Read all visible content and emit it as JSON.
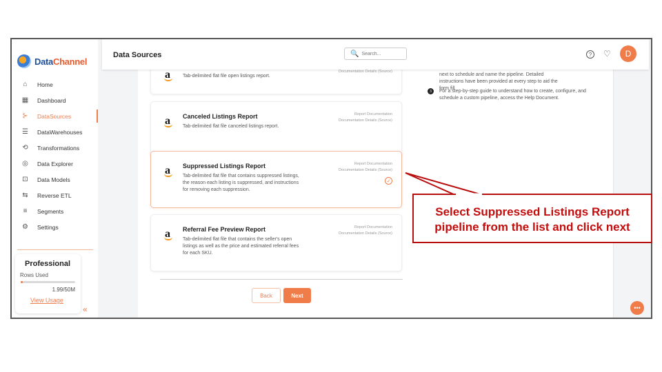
{
  "app": {
    "logo": {
      "brand_part1": "Data",
      "brand_part2": "Channel"
    }
  },
  "sidebar": {
    "items": [
      {
        "label": "Home",
        "icon": "home-icon",
        "glyph": "⌂"
      },
      {
        "label": "Dashboard",
        "icon": "dashboard-icon",
        "glyph": "▦"
      },
      {
        "label": "DataSources",
        "icon": "datasources-icon",
        "glyph": "⊱"
      },
      {
        "label": "DataWarehouses",
        "icon": "datawarehouses-icon",
        "glyph": "☰"
      },
      {
        "label": "Transformations",
        "icon": "transformations-icon",
        "glyph": "⟲"
      },
      {
        "label": "Data Explorer",
        "icon": "data-explorer-icon",
        "glyph": "◎"
      },
      {
        "label": "Data Models",
        "icon": "data-models-icon",
        "glyph": "⊡"
      },
      {
        "label": "Reverse ETL",
        "icon": "reverse-etl-icon",
        "glyph": "⇆"
      },
      {
        "label": "Segments",
        "icon": "segments-icon",
        "glyph": "≡"
      },
      {
        "label": "Settings",
        "icon": "settings-icon",
        "glyph": "⚙"
      }
    ],
    "active_index": 2,
    "plan": {
      "title": "Professional",
      "rows_label": "Rows Used",
      "rows_value": "1.99/50M",
      "usage_fraction": 0.04,
      "view_usage": "View Usage"
    }
  },
  "header": {
    "title": "Data Sources",
    "search_placeholder": "Search...",
    "avatar_initial": "D"
  },
  "reports": [
    {
      "name": "",
      "desc": "Tab-delimited flat file open listings report.",
      "doc_lines": [
        "Documentation Details (Source)"
      ],
      "selected": false
    },
    {
      "name": "Canceled Listings Report",
      "desc": "Tab-delimited flat file canceled listings report.",
      "doc_lines": [
        "Report Documentation",
        "Documentation Details (Source)"
      ],
      "selected": false
    },
    {
      "name": "Suppressed Listings Report",
      "desc": "Tab-delimited flat file that contains suppressed listings, the reason each listing is suppressed, and instructions for removing each suppression.",
      "doc_lines": [
        "Report Documentation",
        "Documentation Details (Source)"
      ],
      "selected": true
    },
    {
      "name": "Referral Fee Preview Report",
      "desc": "Tab-delimited flat file that contains the seller's open listings as well as the price and estimated referral fees for each SKU.",
      "doc_lines": [
        "Report Documentation",
        "Documentation Details (Source)"
      ],
      "selected": false
    }
  ],
  "buttons": {
    "back": "Back",
    "next": "Next"
  },
  "right_panel": {
    "line1": "next to schedule and name the pipeline. Detailed",
    "line2": "instructions have been provided at every step to aid the",
    "line3": "form fill",
    "step_number": "3",
    "step_text": "For a step-by-step guide to understand how to create, configure, and schedule a custom pipeline, access the Help Document."
  },
  "callout": {
    "line1": "Select Suppressed Listings Report",
    "line2": "pipeline from the list and click next"
  },
  "colors": {
    "accent": "#f07c4a",
    "callout_red": "#c30c0c"
  }
}
